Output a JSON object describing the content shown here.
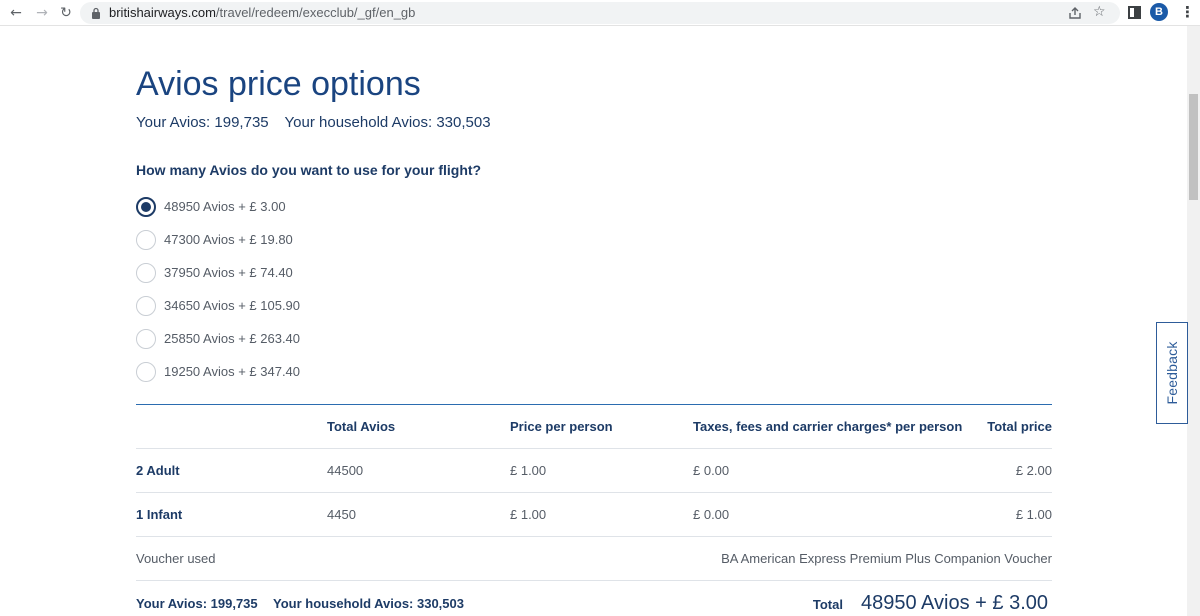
{
  "browser": {
    "url_host": "britishairways.com",
    "url_path": "/travel/redeem/execclub/_gf/en_gb",
    "profile_initial": "B"
  },
  "page": {
    "title": "Avios price options",
    "your_avios_label": "Your Avios:",
    "your_avios_value": "199,735",
    "household_avios_label": "Your household Avios:",
    "household_avios_value": "330,503",
    "question": "How many Avios do you want to use for your flight?"
  },
  "options": [
    {
      "label": "48950 Avios + £ 3.00",
      "selected": true
    },
    {
      "label": "47300 Avios + £ 19.80",
      "selected": false
    },
    {
      "label": "37950 Avios + £ 74.40",
      "selected": false
    },
    {
      "label": "34650 Avios + £ 105.90",
      "selected": false
    },
    {
      "label": "25850 Avios + £ 263.40",
      "selected": false
    },
    {
      "label": "19250 Avios + £ 347.40",
      "selected": false
    }
  ],
  "table": {
    "headers": {
      "total_avios": "Total Avios",
      "price_per_person": "Price per person",
      "taxes": "Taxes, fees and carrier charges* per person",
      "total_price": "Total price"
    },
    "rows": [
      {
        "label": "2 Adult",
        "total_avios": "44500",
        "price_per_person": "£ 1.00",
        "taxes": "£ 0.00",
        "total_price": "£ 2.00"
      },
      {
        "label": "1 Infant",
        "total_avios": "4450",
        "price_per_person": "£ 1.00",
        "taxes": "£ 0.00",
        "total_price": "£ 1.00"
      }
    ],
    "voucher_label": "Voucher used",
    "voucher_value": "BA American Express Premium Plus Companion Voucher"
  },
  "footer": {
    "your_avios": "Your Avios: 199,735",
    "household_avios": "Your household Avios: 330,503",
    "total_label": "Total",
    "total_value": "48950 Avios +  £ 3.00"
  },
  "feedback_label": "Feedback",
  "colors": {
    "brand_navy": "#1d3b66",
    "title_blue": "#1a4480",
    "divider_blue": "#2b6cb0"
  }
}
